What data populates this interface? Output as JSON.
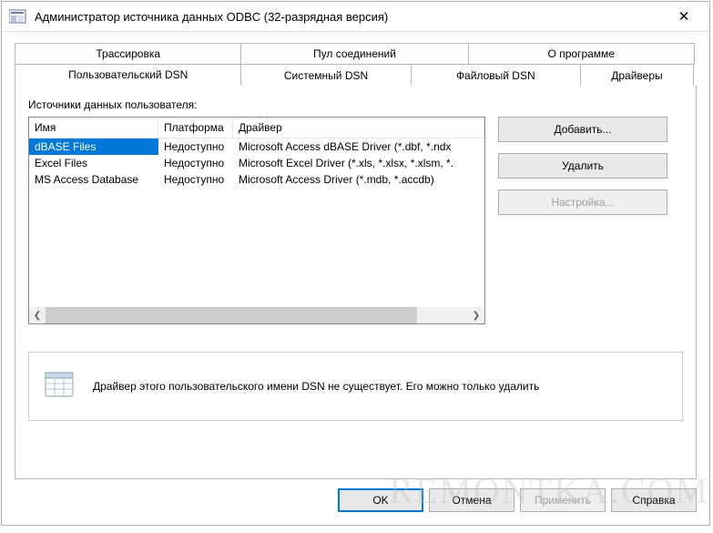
{
  "window": {
    "title": "Администратор источника данных ODBC (32-разрядная версия)"
  },
  "tabs_back": [
    {
      "label": "Трассировка"
    },
    {
      "label": "Пул соединений"
    },
    {
      "label": "О программе"
    }
  ],
  "tabs_front": [
    {
      "label": "Пользовательский DSN",
      "active": true
    },
    {
      "label": "Системный DSN"
    },
    {
      "label": "Файловый DSN"
    },
    {
      "label": "Драйверы"
    }
  ],
  "panel": {
    "sources_label": "Источники данных пользователя:",
    "columns": {
      "name": "Имя",
      "platform": "Платформа",
      "driver": "Драйвер"
    },
    "rows": [
      {
        "name": "dBASE Files",
        "platform": "Недоступно",
        "driver": "Microsoft Access dBASE Driver (*.dbf, *.ndx",
        "selected": true
      },
      {
        "name": "Excel Files",
        "platform": "Недоступно",
        "driver": "Microsoft Excel Driver (*.xls, *.xlsx, *.xlsm, *.",
        "selected": false
      },
      {
        "name": "MS Access Database",
        "platform": "Недоступно",
        "driver": "Microsoft Access Driver (*.mdb, *.accdb)",
        "selected": false
      }
    ],
    "buttons": {
      "add": "Добавить...",
      "remove": "Удалить",
      "configure": "Настройка..."
    },
    "info_text": "Драйвер этого пользовательского имени DSN не существует. Его можно только удалить"
  },
  "footer": {
    "ok": "OK",
    "cancel": "Отмена",
    "apply": "Применить",
    "help": "Справка"
  },
  "watermark": "REMONTKA.COM"
}
